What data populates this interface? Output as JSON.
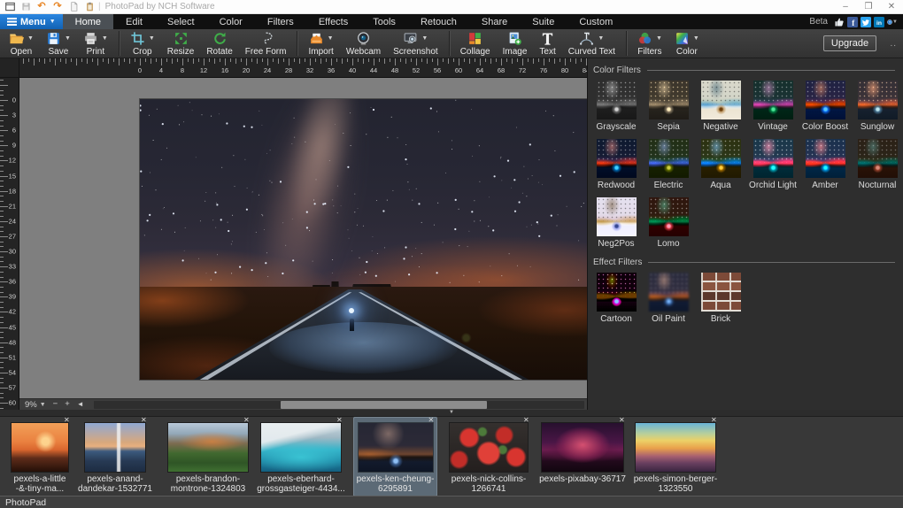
{
  "window": {
    "title": "PhotoPad by NCH Software",
    "quick_access": [
      "app",
      "save",
      "undo",
      "redo",
      "new-page",
      "paste"
    ],
    "controls": [
      {
        "name": "minimize",
        "glyph": "–"
      },
      {
        "name": "restore",
        "glyph": "❒"
      },
      {
        "name": "close",
        "glyph": "✕"
      }
    ]
  },
  "menu_bar": {
    "menu_button_label": "Menu",
    "tabs": [
      {
        "label": "Home",
        "active": true
      },
      {
        "label": "Edit",
        "active": false
      },
      {
        "label": "Select",
        "active": false
      },
      {
        "label": "Color",
        "active": false
      },
      {
        "label": "Filters",
        "active": false
      },
      {
        "label": "Effects",
        "active": false
      },
      {
        "label": "Tools",
        "active": false
      },
      {
        "label": "Retouch",
        "active": false
      },
      {
        "label": "Share",
        "active": false
      },
      {
        "label": "Suite",
        "active": false
      },
      {
        "label": "Custom",
        "active": false
      }
    ],
    "beta_label": "Beta",
    "social_icons": [
      "thumbs-up",
      "facebook",
      "twitter",
      "linkedin",
      "help"
    ]
  },
  "toolbar": {
    "groups": [
      {
        "buttons": [
          {
            "label": "Open",
            "icon": "folder-open",
            "dropdown": true
          },
          {
            "label": "Save",
            "icon": "floppy",
            "dropdown": true
          },
          {
            "label": "Print",
            "icon": "printer",
            "dropdown": true
          }
        ]
      },
      {
        "buttons": [
          {
            "label": "Crop",
            "icon": "crop",
            "dropdown": true
          },
          {
            "label": "Resize",
            "icon": "resize",
            "dropdown": false
          },
          {
            "label": "Rotate",
            "icon": "rotate",
            "dropdown": false
          },
          {
            "label": "Free Form",
            "icon": "free-form",
            "dropdown": false
          }
        ]
      },
      {
        "buttons": [
          {
            "label": "Import",
            "icon": "import",
            "dropdown": true
          },
          {
            "label": "Webcam",
            "icon": "webcam",
            "dropdown": false
          },
          {
            "label": "Screenshot",
            "icon": "screenshot",
            "dropdown": true
          }
        ]
      },
      {
        "buttons": [
          {
            "label": "Collage",
            "icon": "collage",
            "dropdown": false
          },
          {
            "label": "Image",
            "icon": "image",
            "dropdown": false
          },
          {
            "label": "Text",
            "icon": "text",
            "dropdown": false
          },
          {
            "label": "Curved Text",
            "icon": "curved-text",
            "dropdown": true
          }
        ]
      },
      {
        "buttons": [
          {
            "label": "Filters",
            "icon": "filters",
            "dropdown": true
          },
          {
            "label": "Color",
            "icon": "color",
            "dropdown": true
          }
        ]
      }
    ],
    "upgrade_label": "Upgrade",
    "more_label": ".."
  },
  "rulers": {
    "horizontal": {
      "label_step": 4,
      "min_label": 0,
      "max_label": 84
    },
    "vertical": {
      "label_step": 3,
      "min_label": 0,
      "max_label": 60
    }
  },
  "canvas": {
    "zoom_level": "9%",
    "controls": {
      "zoom_out": "−",
      "zoom_in": "+",
      "scroll_left": "◄"
    }
  },
  "splitter": {
    "collapse_glyph": "▼"
  },
  "filter_panel": {
    "sections": [
      {
        "title": "Color Filters",
        "filters": [
          "Grayscale",
          "Sepia",
          "Negative",
          "Vintage",
          "Color Boost",
          "Sunglow",
          "Redwood",
          "Electric",
          "Aqua",
          "Orchid Light",
          "Amber",
          "Nocturnal",
          "Neg2Pos",
          "Lomo"
        ]
      },
      {
        "title": "Effect Filters",
        "filters": [
          "Cartoon",
          "Oil Paint",
          "Brick"
        ]
      }
    ]
  },
  "filmstrip": {
    "items": [
      {
        "name": "pexels-a-little\n-&-tiny-ma...",
        "selected": false
      },
      {
        "name": "pexels-anand-\ndandekar-1532771",
        "selected": false
      },
      {
        "name": "pexels-brandon-\nmontrone-1324803",
        "selected": false
      },
      {
        "name": "pexels-eberhard-\ngrossgasteiger-4434...",
        "selected": false
      },
      {
        "name": "pexels-ken-cheung-\n6295891",
        "selected": true
      },
      {
        "name": "pexels-nick-collins-\n1266741",
        "selected": false
      },
      {
        "name": "pexels-pixabay-36717",
        "selected": false
      },
      {
        "name": "pexels-simon-berger-\n1323550",
        "selected": false
      }
    ]
  },
  "status_bar": {
    "text": "PhotoPad"
  },
  "colors": {
    "accent_blue": "#1e74c8",
    "panel_bg": "#2e2e2e",
    "canvas_bg": "#7f7f7f",
    "selected_thumb_bg": "#5c6a76"
  }
}
